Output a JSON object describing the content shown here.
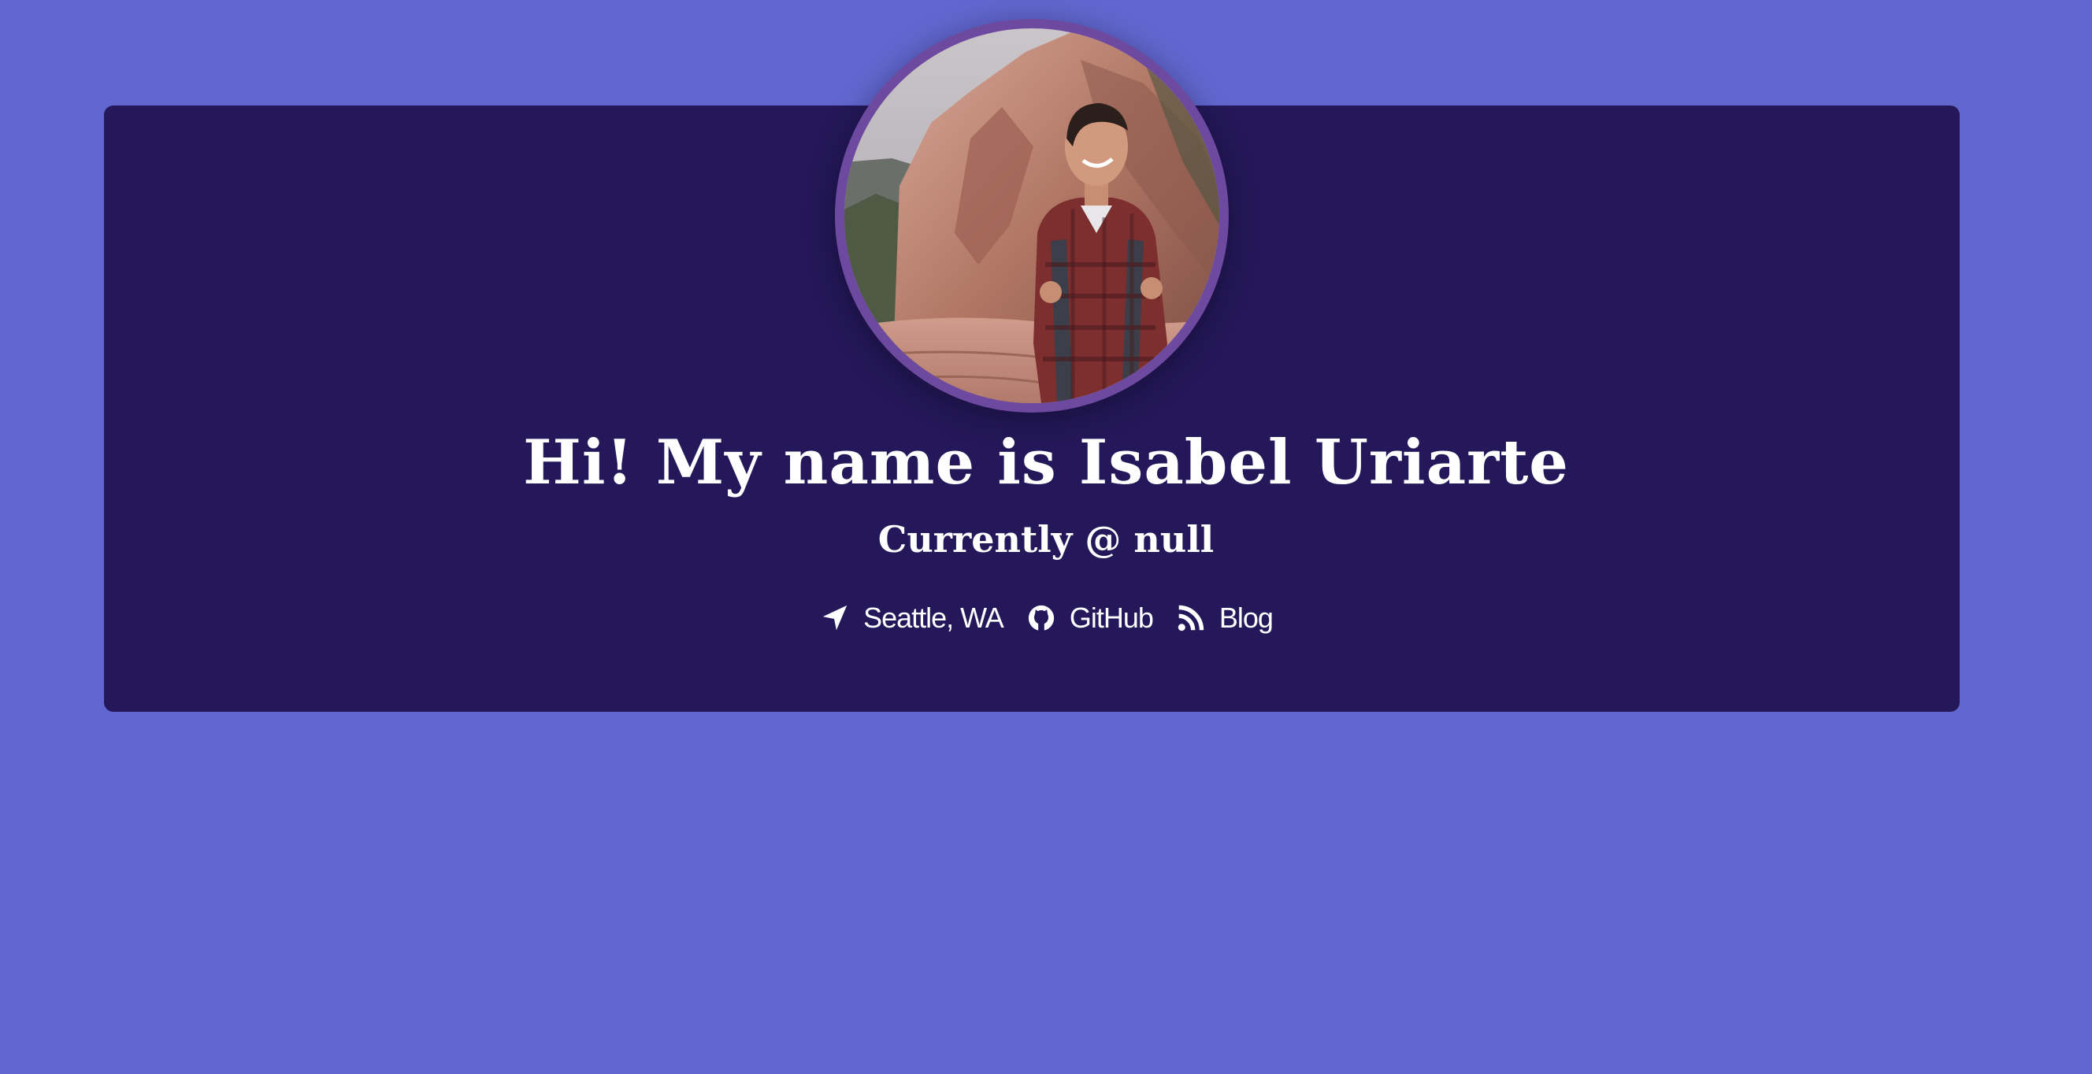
{
  "profile": {
    "title": "Hi! My name is Isabel Uriarte",
    "subtitle": "Currently @ null",
    "avatar_alt": "Isabel Uriarte"
  },
  "links": [
    {
      "label": "Seattle, WA",
      "icon": "location-arrow-icon"
    },
    {
      "label": "GitHub",
      "icon": "github-icon"
    },
    {
      "label": "Blog",
      "icon": "rss-icon"
    }
  ],
  "colors": {
    "page_background": "#6167cf",
    "card_background": "#24185a",
    "avatar_ring": "#6d4aa0",
    "text": "#ffffff"
  }
}
